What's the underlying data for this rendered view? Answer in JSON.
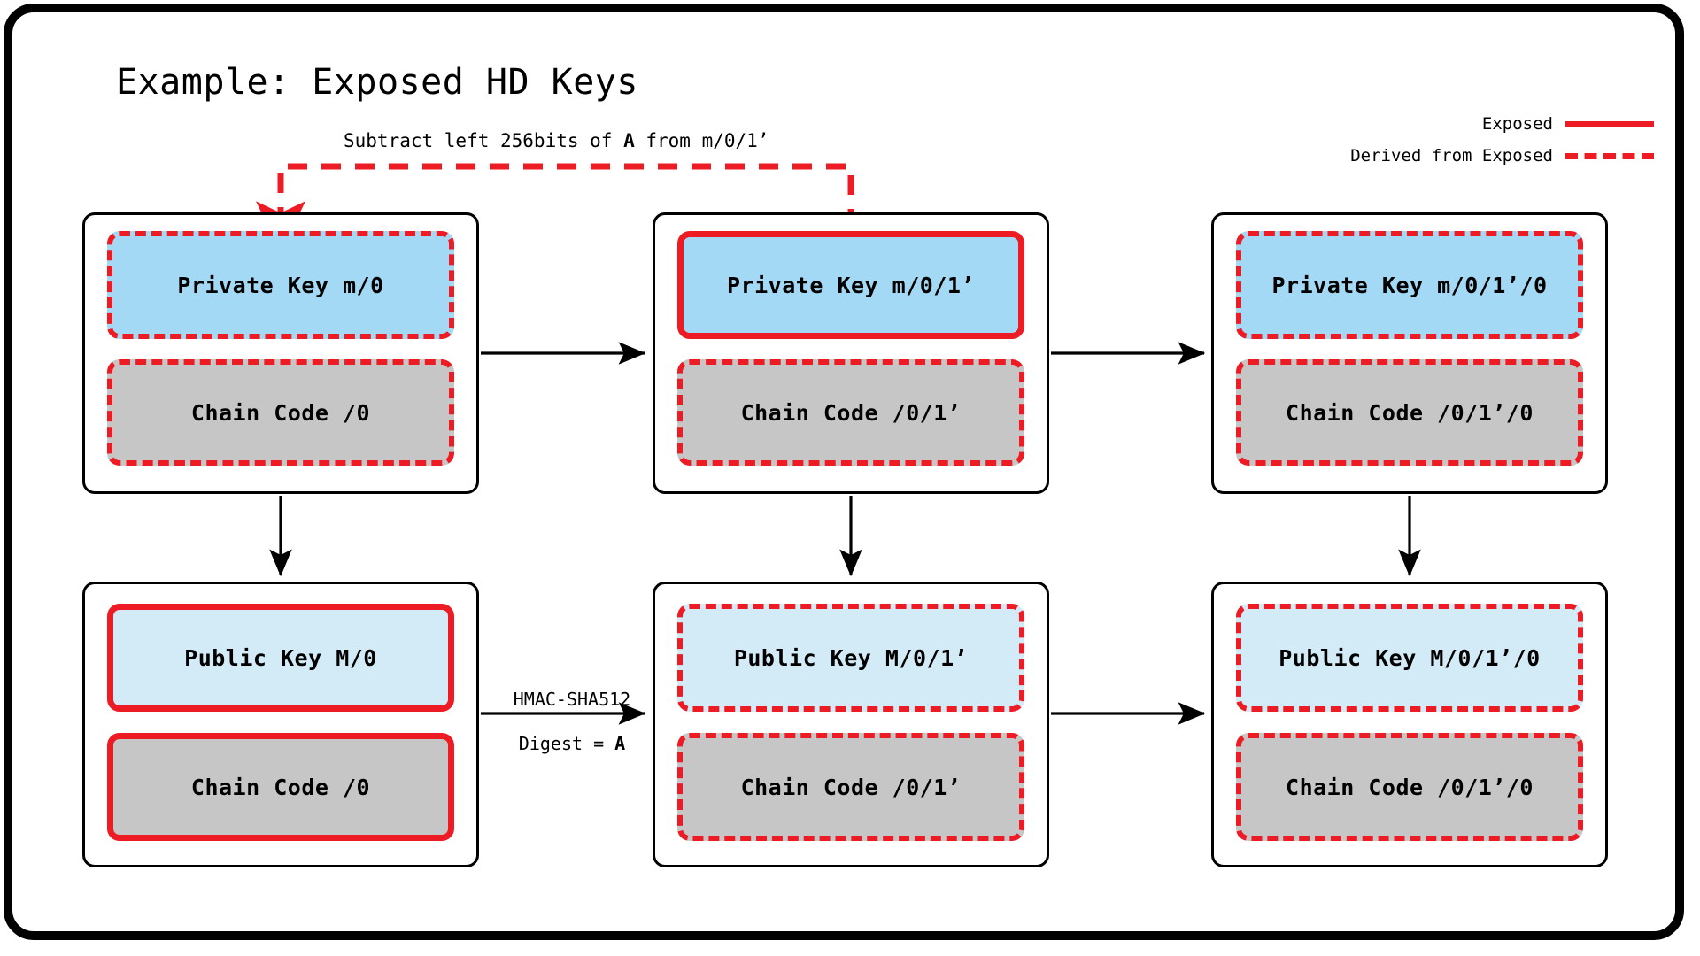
{
  "diagram": {
    "title": "Example: Exposed HD Keys",
    "legend": {
      "items": [
        {
          "label": "Exposed",
          "style": "solid",
          "color": "#ED1C24"
        },
        {
          "label": "Derived from Exposed",
          "style": "dashed",
          "color": "#ED1C24"
        }
      ]
    },
    "annotations": {
      "subtract_prefix": "Subtract left 256bits of ",
      "subtract_bold": "A",
      "subtract_suffix": " from m/0/1’",
      "hmac_top": "HMAC-SHA512",
      "hmac_bottom_prefix": "Digest = ",
      "hmac_bottom_bold": "A"
    },
    "colors": {
      "exposed": "#ED1C24",
      "private_key_fill": "#A3D9F5",
      "public_key_fill": "#D3EAF7",
      "chain_code_fill": "#C6C6C6",
      "card_border": "#000000",
      "arrow": "#000000",
      "background": "#FFFFFF"
    },
    "cards": [
      {
        "id": "private-m-0",
        "key_label": "Private Key m/0",
        "key_state": "derived",
        "chain_label": "Chain Code /0",
        "chain_state": "derived"
      },
      {
        "id": "private-m-0-1h",
        "key_label": "Private Key m/0/1’",
        "key_state": "exposed",
        "chain_label": "Chain Code /0/1’",
        "chain_state": "derived"
      },
      {
        "id": "private-m-0-1h-0",
        "key_label": "Private Key m/0/1’/0",
        "key_state": "derived",
        "chain_label": "Chain Code /0/1’/0",
        "chain_state": "derived"
      },
      {
        "id": "public-M-0",
        "key_label": "Public Key M/0",
        "key_state": "exposed",
        "chain_label": "Chain Code /0",
        "chain_state": "exposed"
      },
      {
        "id": "public-M-0-1h",
        "key_label": "Public Key M/0/1’",
        "key_state": "derived",
        "chain_label": "Chain Code /0/1’",
        "chain_state": "derived"
      },
      {
        "id": "public-M-0-1h-0",
        "key_label": "Public Key M/0/1’/0",
        "key_state": "derived",
        "chain_label": "Chain Code /0/1’/0",
        "chain_state": "derived"
      }
    ]
  }
}
